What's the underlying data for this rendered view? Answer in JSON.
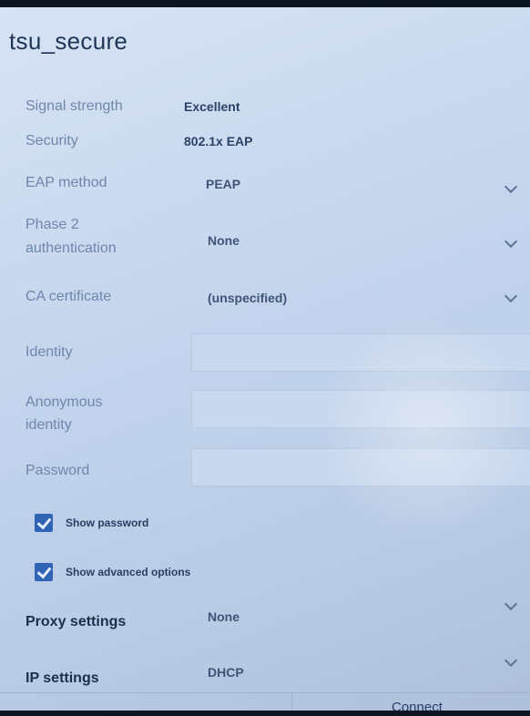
{
  "dialog": {
    "title": "tsu_secure",
    "signal": {
      "label": "Signal strength",
      "value": "Excellent"
    },
    "security": {
      "label": "Security",
      "value": "802.1x EAP"
    },
    "eap_method": {
      "label": "EAP method",
      "value": "PEAP"
    },
    "phase2": {
      "label_line1": "Phase 2",
      "label_line2": "authentication",
      "value": "None"
    },
    "ca_cert": {
      "label": "CA certificate",
      "value": "(unspecified)"
    },
    "identity": {
      "label": "Identity",
      "value": ""
    },
    "anonymous": {
      "label_line1": "Anonymous",
      "label_line2": "identity",
      "value": ""
    },
    "password": {
      "label": "Password",
      "value": ""
    },
    "show_password": {
      "label": "Show password",
      "checked": true
    },
    "show_advanced": {
      "label": "Show advanced options",
      "checked": true
    },
    "proxy": {
      "label": "Proxy settings",
      "value": "None"
    },
    "ip": {
      "label": "IP settings",
      "value": "DHCP"
    },
    "connect_label": "Connect"
  }
}
